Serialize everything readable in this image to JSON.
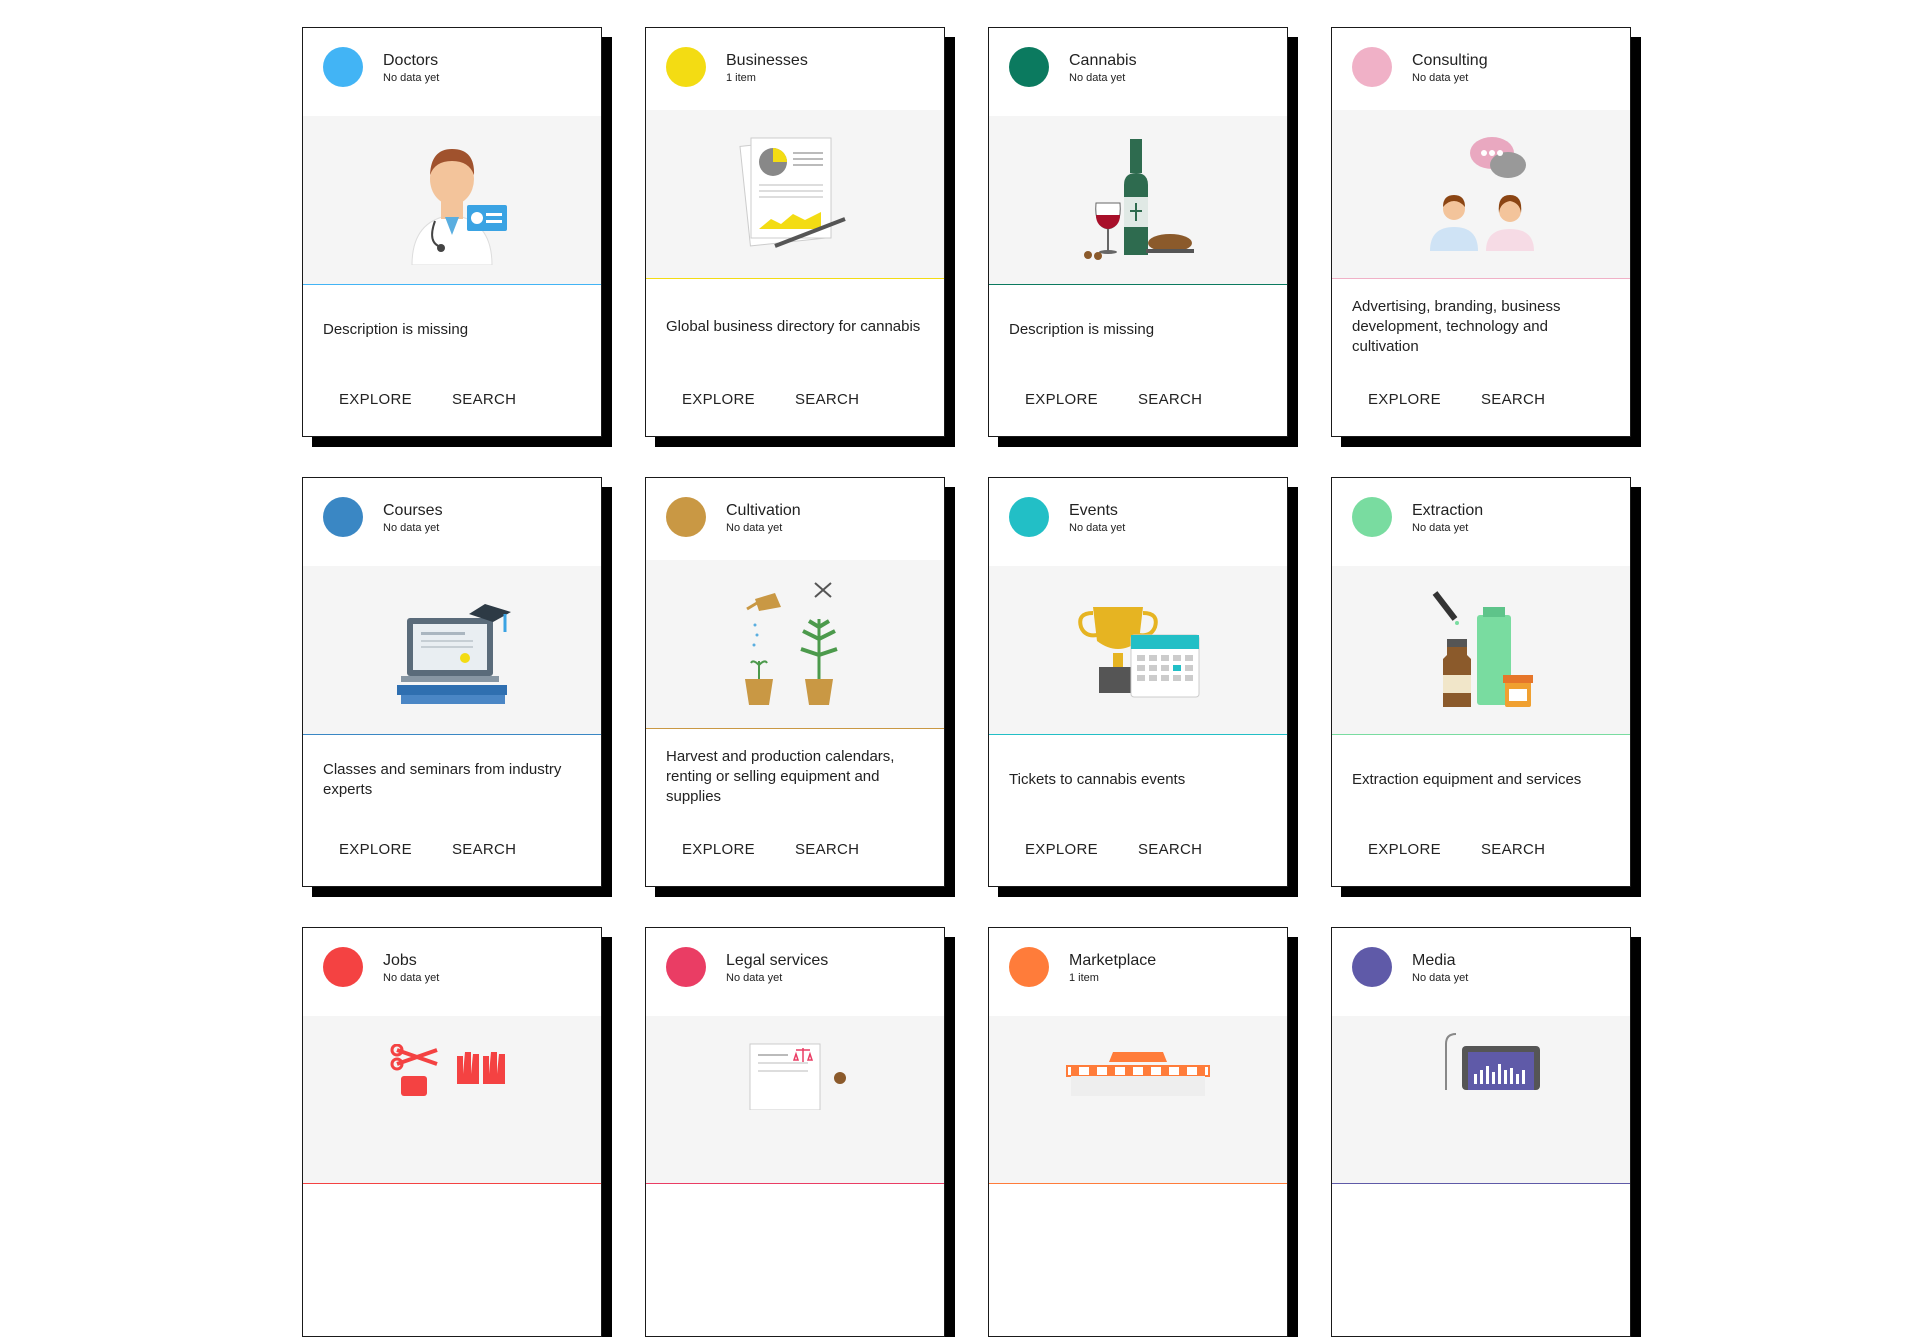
{
  "actions": {
    "explore": "EXPLORE",
    "search": "SEARCH"
  },
  "cards": [
    {
      "title": "Doctors",
      "sub": "No data yet",
      "color": "#42b4f5",
      "desc": "Description is missing",
      "icon": "doctor-icon"
    },
    {
      "title": "Businesses",
      "sub": "1 item",
      "color": "#f3dc13",
      "desc": "Global business directory for cannabis",
      "icon": "business-report-icon"
    },
    {
      "title": "Cannabis",
      "sub": "No data yet",
      "color": "#0b7a5f",
      "desc": "Description is missing",
      "icon": "wine-bottle-icon"
    },
    {
      "title": "Consulting",
      "sub": "No data yet",
      "color": "#f0b1c7",
      "desc": "Advertising, branding, business development, technology and cultivation",
      "icon": "consulting-chat-icon"
    },
    {
      "title": "Courses",
      "sub": "No data yet",
      "color": "#3a87c4",
      "desc": "Classes and seminars from industry experts",
      "icon": "laptop-graduation-icon"
    },
    {
      "title": "Cultivation",
      "sub": "No data yet",
      "color": "#c99844",
      "desc": "Harvest and production calendars, renting or selling equipment and supplies",
      "icon": "plant-pots-icon"
    },
    {
      "title": "Events",
      "sub": "No data yet",
      "color": "#22bfc6",
      "desc": "Tickets to cannabis events",
      "icon": "trophy-calendar-icon"
    },
    {
      "title": "Extraction",
      "sub": "No data yet",
      "color": "#79dca0",
      "desc": "Extraction equipment and services",
      "icon": "dropper-bottles-icon"
    },
    {
      "title": "Jobs",
      "sub": "No data yet",
      "color": "#f44242",
      "desc": "",
      "icon": "scissors-gloves-icon"
    },
    {
      "title": "Legal services",
      "sub": "No data yet",
      "color": "#ea3d64",
      "desc": "",
      "icon": "legal-document-icon"
    },
    {
      "title": "Marketplace",
      "sub": "1 item",
      "color": "#ff7c3a",
      "desc": "",
      "icon": "market-stall-icon"
    },
    {
      "title": "Media",
      "sub": "No data yet",
      "color": "#5f5aa8",
      "desc": "",
      "icon": "media-tablet-icon"
    }
  ]
}
